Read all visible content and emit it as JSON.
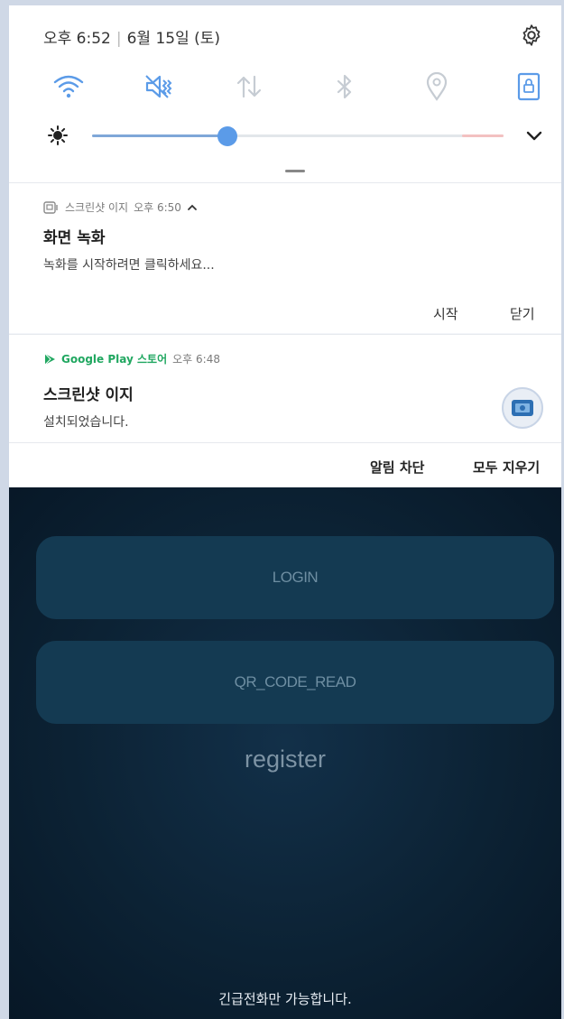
{
  "status": {
    "time": "오후 6:52",
    "date": "6월 15일 (토)"
  },
  "quick_settings": {
    "tiles": [
      "wifi-icon",
      "mute-vibrate-icon",
      "mobile-data-icon",
      "bluetooth-icon",
      "location-icon",
      "screen-lock-icon"
    ],
    "brightness_level": 0.33,
    "colors": {
      "active": "#5b9be8",
      "inactive": "#c6ccd3"
    }
  },
  "notifications": [
    {
      "app": "스크린샷 이지",
      "time": "오후 6:50",
      "title": "화면 녹화",
      "body": "녹화를 시작하려면 클릭하세요...",
      "actions": [
        "시작",
        "닫기"
      ]
    },
    {
      "app": "Google Play 스토어",
      "time": "오후 6:48",
      "title": "스크린샷 이지",
      "body": "설치되었습니다."
    }
  ],
  "panel_actions": {
    "block": "알림 차단",
    "clear_all": "모두 지우기"
  },
  "app": {
    "login_label": "LOGIN",
    "qr_label": "QR_CODE_READ",
    "register_label": "register",
    "emergency_text": "긴급전화만 가능합니다."
  }
}
